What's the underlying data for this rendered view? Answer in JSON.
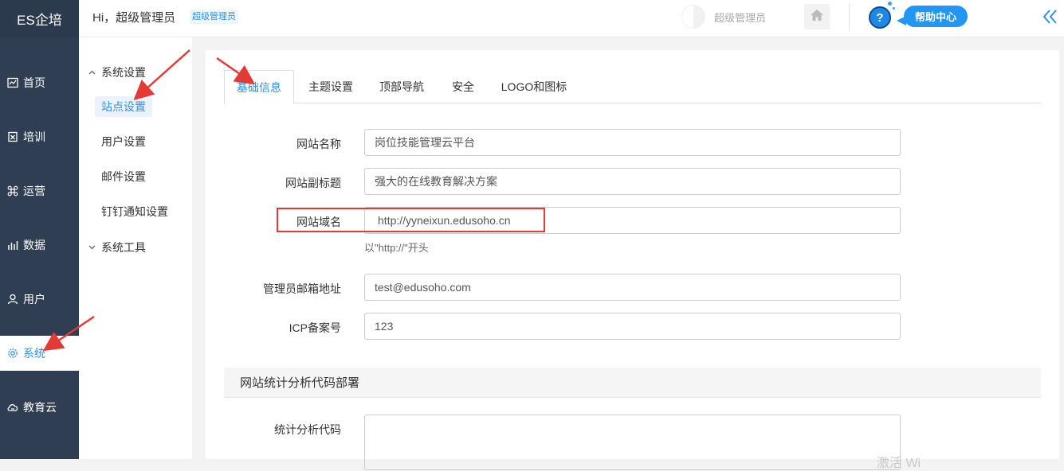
{
  "brand": "ES企培",
  "header": {
    "greeting": "Hi，超级管理员",
    "role_badge": "超级管理员",
    "user_name": "超级管理员",
    "home_icon": "home-icon",
    "help_icon": "question-icon",
    "help_label": "帮助中心",
    "collapse_icon": "double-chevron-left-icon"
  },
  "sidebar": {
    "items": [
      {
        "label": "首页",
        "icon": "chart-icon"
      },
      {
        "label": "培训",
        "icon": "book-icon"
      },
      {
        "label": "运营",
        "icon": "command-icon"
      },
      {
        "label": "数据",
        "icon": "bar-chart-icon"
      },
      {
        "label": "用户",
        "icon": "user-icon"
      },
      {
        "label": "系统",
        "icon": "gear-icon",
        "active": true
      },
      {
        "label": "教育云",
        "icon": "cloud-icon"
      }
    ]
  },
  "submenu": {
    "group1": "系统设置",
    "items": [
      "站点设置",
      "用户设置",
      "邮件设置",
      "钉钉通知设置"
    ],
    "group2": "系统工具"
  },
  "tabs": [
    "基础信息",
    "主题设置",
    "顶部导航",
    "安全",
    "LOGO和图标"
  ],
  "form": {
    "site_name_label": "网站名称",
    "site_name_value": "岗位技能管理云平台",
    "subtitle_label": "网站副标题",
    "subtitle_value": "强大的在线教育解决方案",
    "domain_label": "网站域名",
    "domain_value": "http://yyneixun.edusoho.cn",
    "domain_help": "以\"http://\"开头",
    "email_label": "管理员邮箱地址",
    "email_value": "test@edusoho.com",
    "icp_label": "ICP备案号",
    "icp_value": "123"
  },
  "analytics": {
    "section_title": "网站统计分析代码部署",
    "code_label": "统计分析代码"
  },
  "watermark": "激活 Wi",
  "colors": {
    "accent": "#3191e8",
    "sidebar_bg": "#2f3e52",
    "highlight": "#e53935"
  }
}
